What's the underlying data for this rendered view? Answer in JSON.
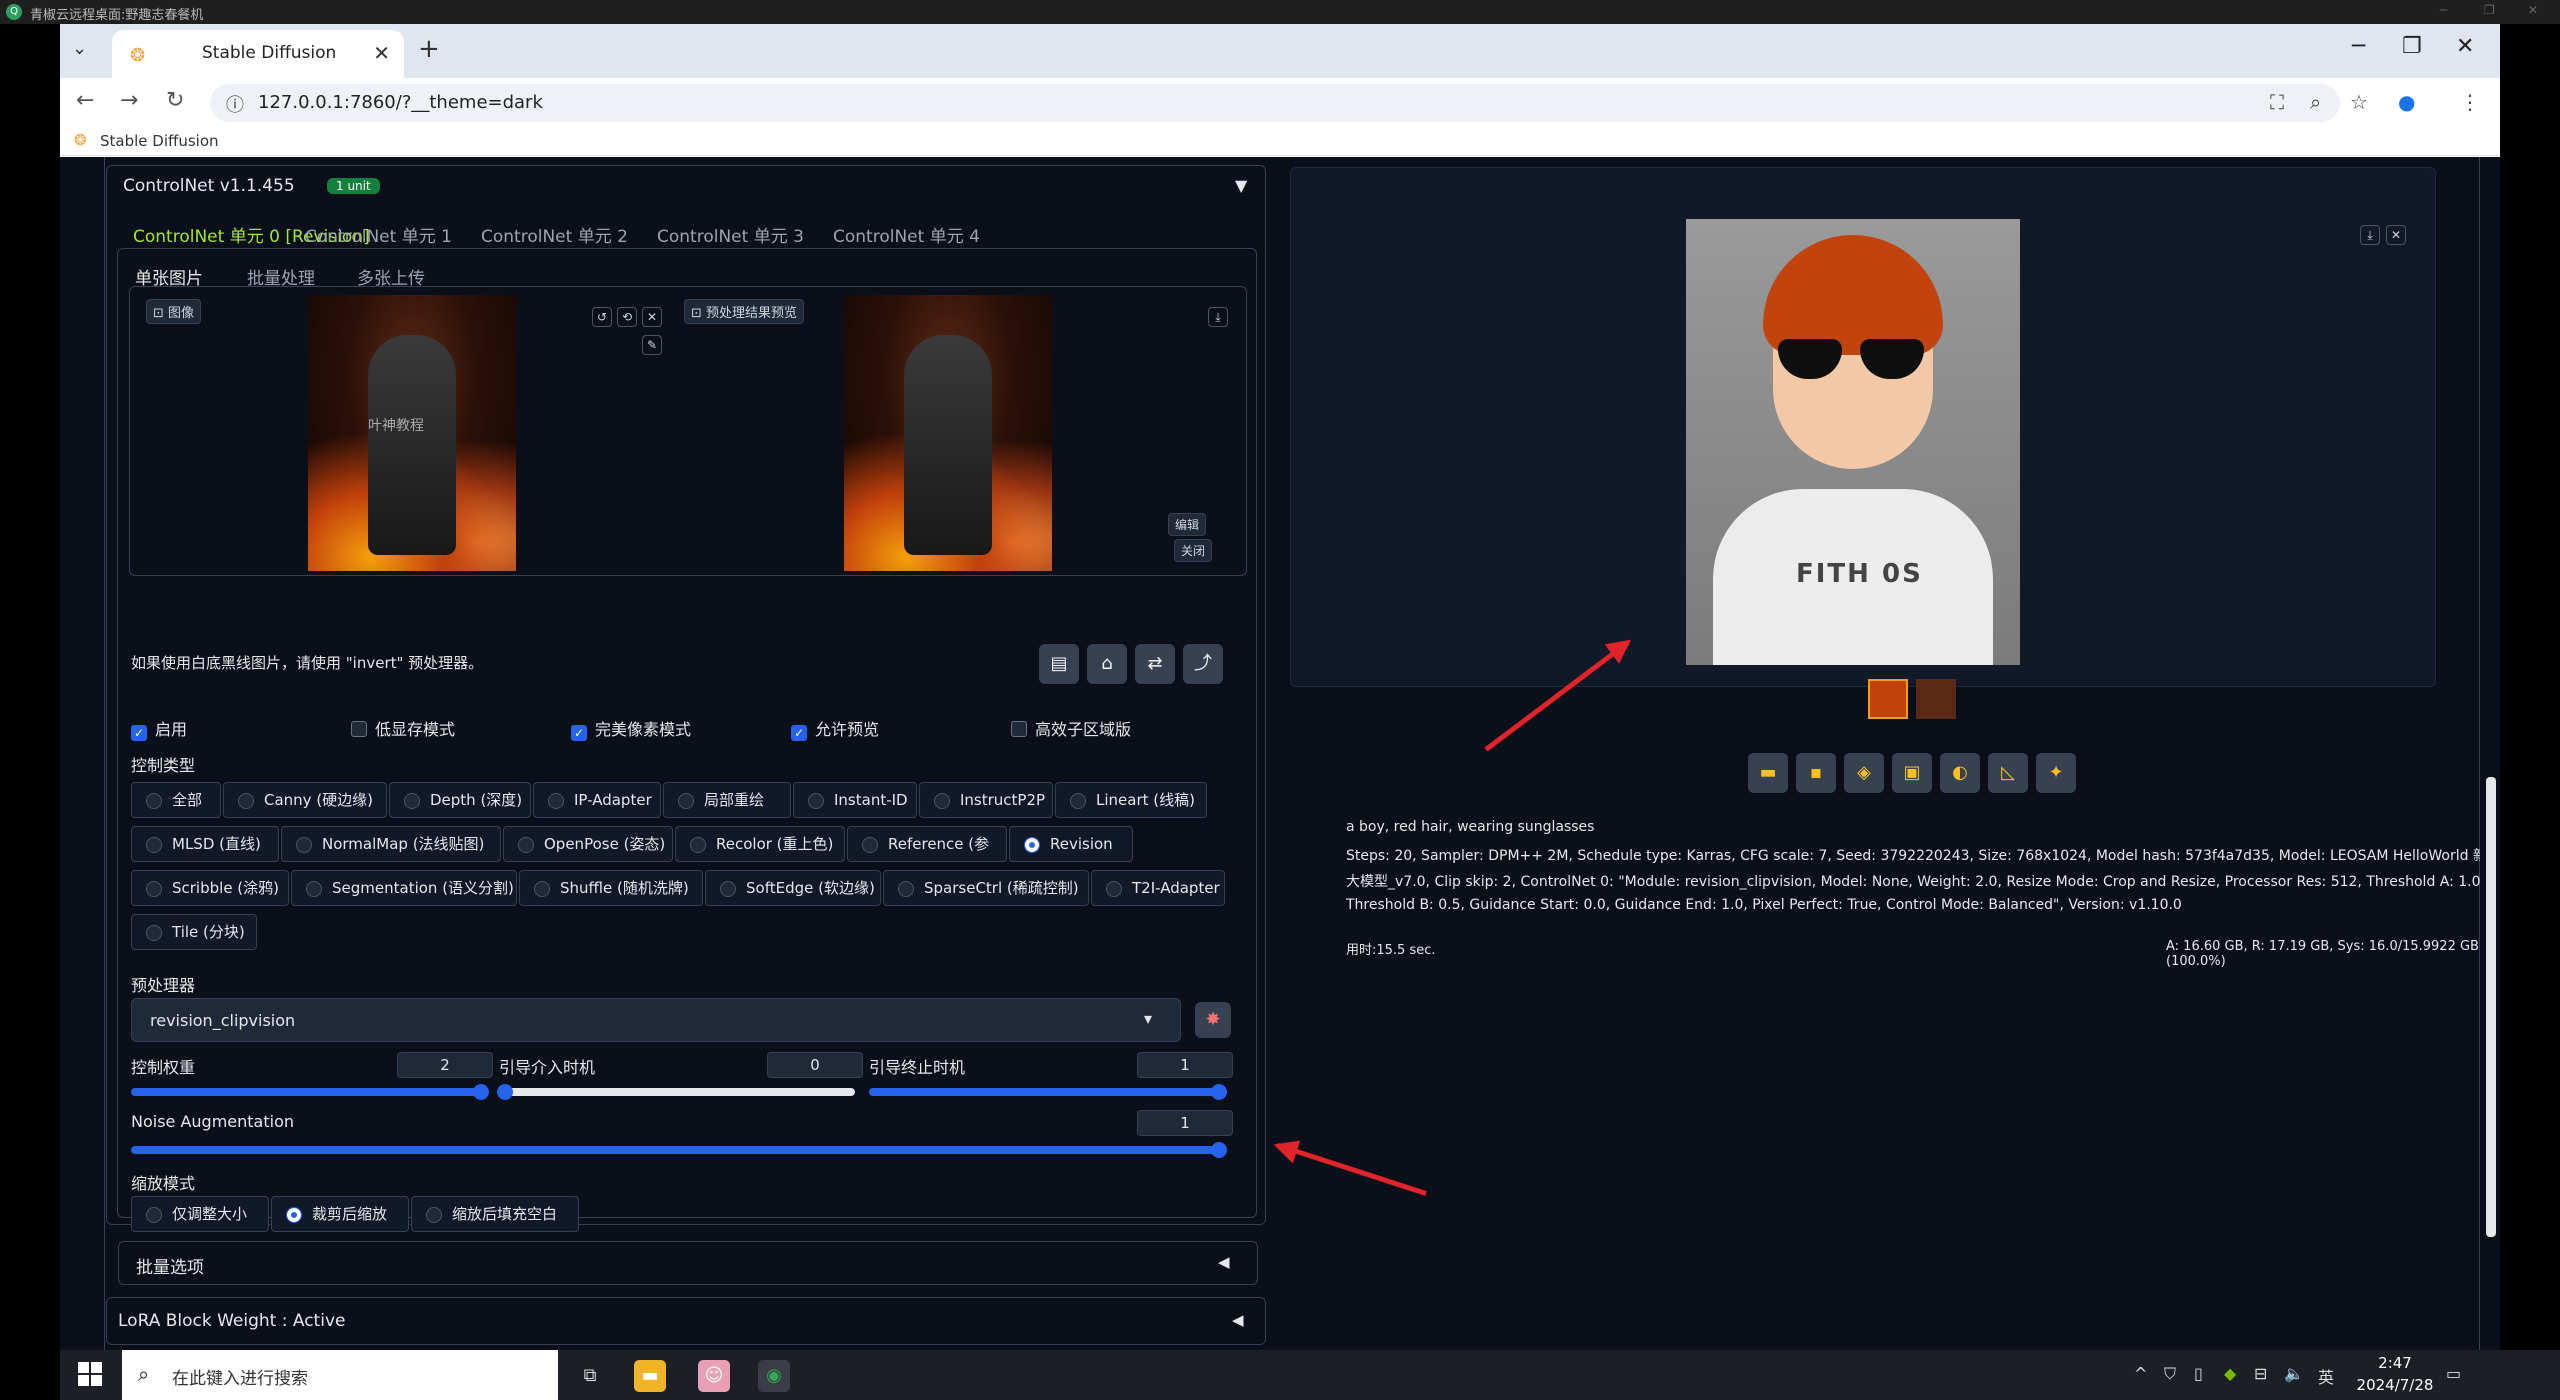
{
  "remote_title": "青椒云远程桌面:野趣志春餐机",
  "browser": {
    "tab_title": "Stable Diffusion",
    "url": "127.0.0.1:7860/?__theme=dark",
    "bookmark": "Stable Diffusion"
  },
  "controlnet": {
    "title": "ControlNet v1.1.455",
    "badge": "1 unit",
    "units": [
      "ControlNet 单元 0 [Revision]",
      "ControlNet 单元 1",
      "ControlNet 单元 2",
      "ControlNet 单元 3",
      "ControlNet 单元 4"
    ],
    "sub_tabs": [
      "单张图片",
      "批量处理",
      "多张上传"
    ],
    "image_chip": "图像",
    "preview_chip": "预处理结果预览",
    "watermark": "叶神教程",
    "edit_btn": "编辑",
    "close_btn": "关闭",
    "hint": "如果使用白底黑线图片，请使用 \"invert\" 预处理器。",
    "checks": [
      {
        "label": "启用",
        "checked": true
      },
      {
        "label": "低显存模式",
        "checked": false
      },
      {
        "label": "完美像素模式",
        "checked": true
      },
      {
        "label": "允许预览",
        "checked": true
      },
      {
        "label": "高效子区域版",
        "checked": false
      }
    ],
    "control_type_label": "控制类型",
    "control_types_row1": [
      "全部",
      "Canny (硬边缘)",
      "Depth (深度)",
      "IP-Adapter",
      "局部重绘",
      "Instant-ID",
      "InstructP2P",
      "Lineart (线稿)"
    ],
    "control_types_row2": [
      "MLSD (直线)",
      "NormalMap (法线贴图)",
      "OpenPose (姿态)",
      "Recolor (重上色)",
      "Reference (参考)",
      "Revision"
    ],
    "control_types_row3": [
      "Scribble (涂鸦)",
      "Segmentation (语义分割)",
      "Shuffle (随机洗牌)",
      "SoftEdge (软边缘)",
      "SparseCtrl (稀疏控制)",
      "T2I-Adapter"
    ],
    "control_types_row4": [
      "Tile (分块)"
    ],
    "selected_type": "Revision",
    "preprocessor_label": "预处理器",
    "preprocessor": "revision_clipvision",
    "weight_label": "控制权重",
    "weight": "2",
    "start_label": "引导介入时机",
    "start": "0",
    "end_label": "引导终止时机",
    "end": "1",
    "noise_label": "Noise Augmentation",
    "noise": "1",
    "resize_label": "缩放模式",
    "resize_modes": [
      "仅调整大小",
      "裁剪后缩放",
      "缩放后填充空白"
    ],
    "resize_selected": "裁剪后缩放",
    "batch_options": "批量选项",
    "lora": "LoRA Block Weight : Active"
  },
  "output": {
    "prompt": "a boy, red hair, wearing sunglasses",
    "params_line1": "Steps: 20, Sampler: DPM++ 2M, Schedule type: Karras, CFG scale: 7, Seed: 3792220243, Size: 768x1024, Model hash: 573f4a7d35, Model: LEOSAM HelloWorld 新世界 _ SDXL",
    "params_line2": "大模型_v7.0, Clip skip: 2, ControlNet 0: \"Module: revision_clipvision, Model: None, Weight: 2.0, Resize Mode: Crop and Resize, Processor Res: 512, Threshold A: 1.0,",
    "params_line3": "Threshold B: 0.5, Guidance Start: 0.0, Guidance End: 1.0, Pixel Perfect: True, Control Mode: Balanced\", Version: v1.10.0",
    "time": "用时:15.5 sec.",
    "vram": "A: 16.60 GB, R: 17.19 GB, Sys: 16.0/15.9922 GB (100.0%)",
    "shirt_print": "FITH 0S"
  },
  "taskbar": {
    "search_placeholder": "在此键入进行搜索",
    "ime": "英",
    "time": "2:47",
    "date": "2024/7/28"
  }
}
